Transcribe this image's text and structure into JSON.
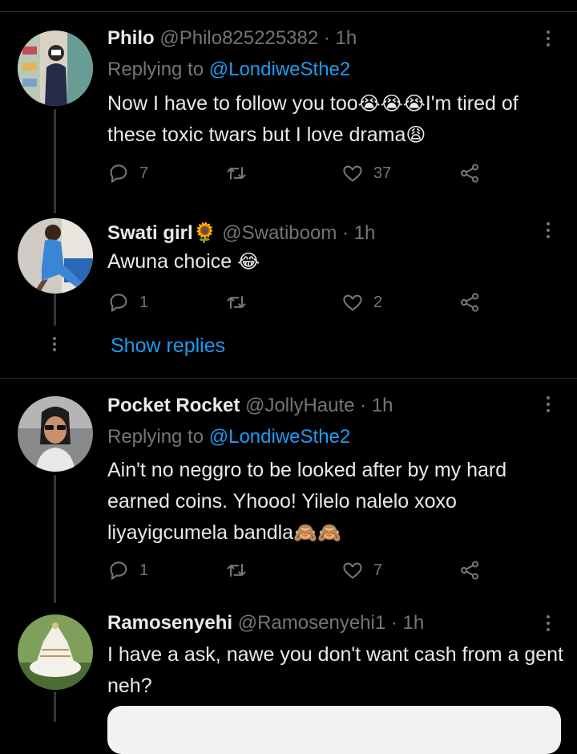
{
  "tweets": [
    {
      "name": "Philo",
      "handle": "@Philo825225382",
      "time": "· 1h",
      "reply_prefix": "Replying to",
      "reply_to": "@LondiweSthe2",
      "text_a": "Now I have to follow you too",
      "emoji_a": "😭😭😭",
      "text_b": "I'm tired of these toxic twars but I love drama",
      "emoji_b": "😩",
      "replies": "7",
      "retweets": "",
      "likes": "37"
    },
    {
      "name": "Swati girl",
      "name_emoji": "🌻",
      "handle": "@Swatiboom",
      "time": "· 1h",
      "text_a": "Awuna choice",
      "emoji_a": "😂",
      "replies": "1",
      "retweets": "",
      "likes": "2"
    },
    {
      "name": "Pocket Rocket",
      "handle": "@JollyHaute",
      "time": "· 1h",
      "reply_prefix": "Replying to",
      "reply_to": "@LondiweSthe2",
      "text_a": "Ain't no neggro to be looked after by my hard earned coins. Yhooo! Yilelo nalelo xoxo liyayigcumela bandla",
      "emoji_a": "🙈🙈",
      "replies": "1",
      "retweets": "",
      "likes": "7"
    },
    {
      "name": "Ramosenyehi",
      "handle": "@Ramosenyehi1",
      "time": "· 1h",
      "text_a": "I have a ask, nawe you don't want cash from a gent neh?"
    }
  ],
  "show_replies": "Show replies",
  "icons": {
    "reply": "reply-icon",
    "retweet": "retweet-icon",
    "like": "heart-icon",
    "share": "share-icon",
    "more": "more-icon"
  },
  "colors": {
    "background": "#000000",
    "text": "#e7e9ea",
    "muted": "#71767b",
    "link": "#1d9bf0",
    "divider": "#2f3336"
  }
}
